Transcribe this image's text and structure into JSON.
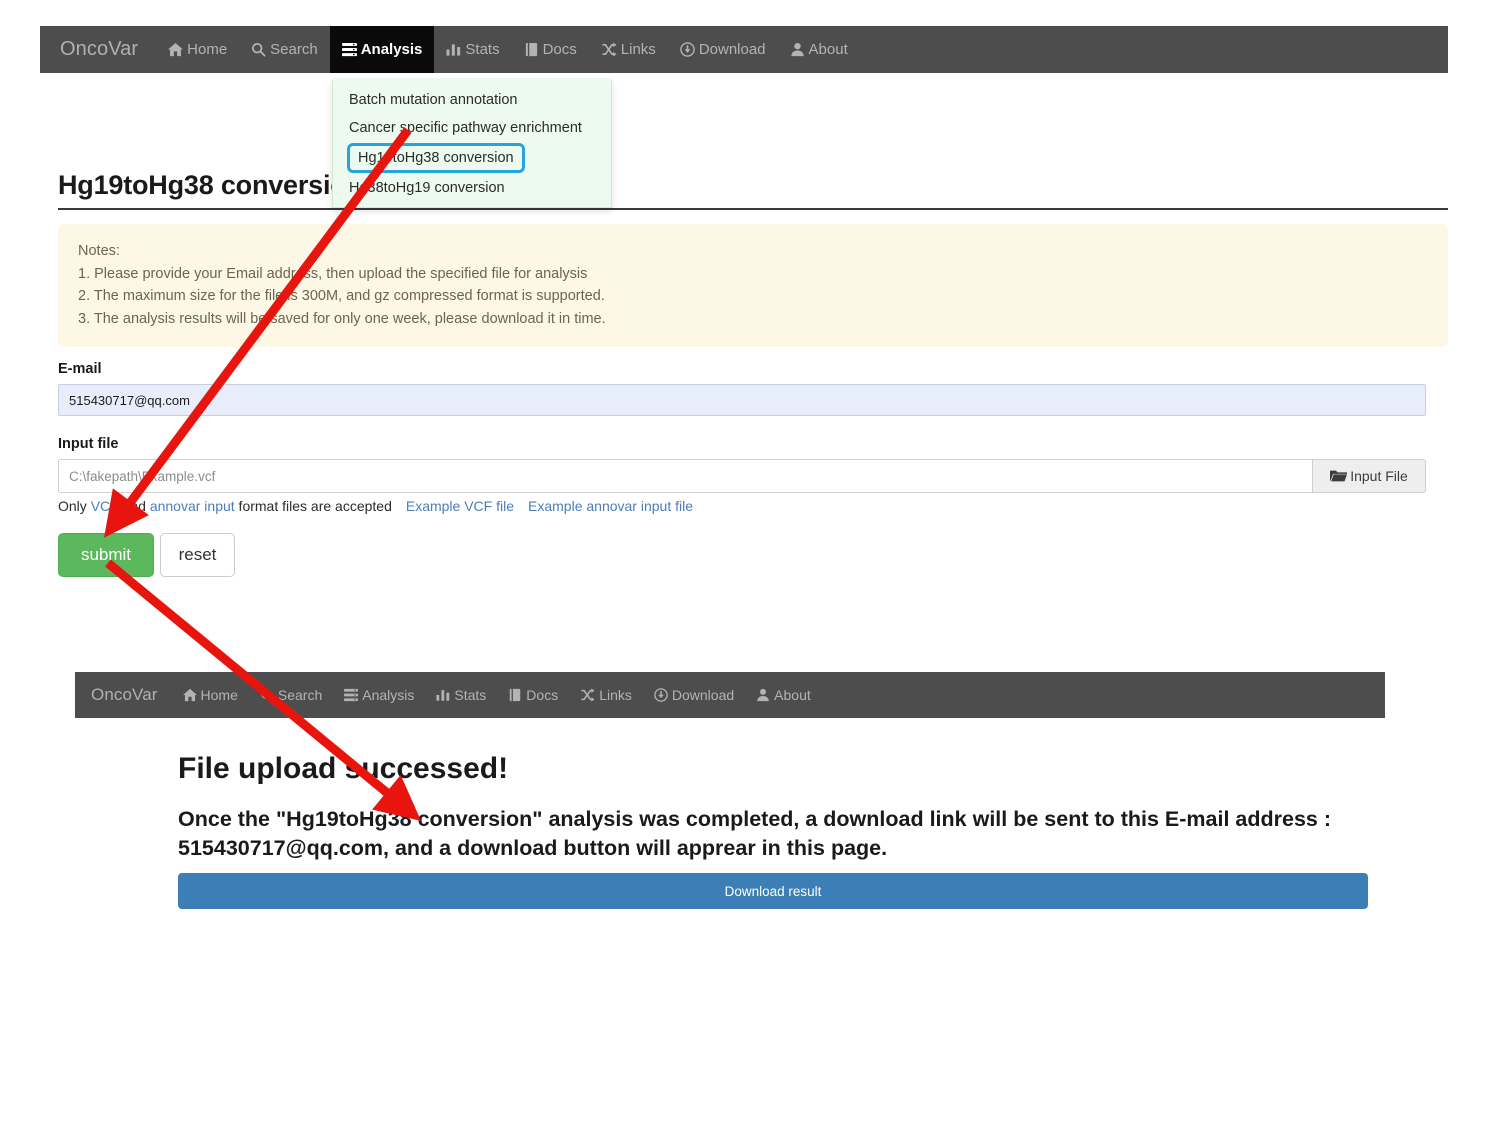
{
  "brand": "OncoVar",
  "nav": {
    "items": [
      {
        "label": "Home",
        "icon": "home-icon"
      },
      {
        "label": "Search",
        "icon": "search-icon"
      },
      {
        "label": "Analysis",
        "icon": "analysis-icon"
      },
      {
        "label": "Stats",
        "icon": "bar-chart-icon"
      },
      {
        "label": "Docs",
        "icon": "book-icon"
      },
      {
        "label": "Links",
        "icon": "shuffle-icon"
      },
      {
        "label": "Download",
        "icon": "download-circle-icon"
      },
      {
        "label": "About",
        "icon": "user-icon"
      }
    ],
    "active": "Analysis"
  },
  "dropdown": {
    "items": [
      "Batch mutation annotation",
      "Cancer specific pathway enrichment",
      "Hg19toHg38 conversion",
      "Hg38toHg19 conversion"
    ],
    "selected": "Hg19toHg38 conversion"
  },
  "page": {
    "title": "Hg19toHg38 conversion"
  },
  "notes": {
    "heading": "Notes:",
    "lines": [
      "1. Please provide your Email address, then upload the specified file for analysis",
      "2. The maximum size for the file is 300M, and gz compressed format is supported.",
      "3. The analysis results will be saved for only one week, please download it in time."
    ]
  },
  "form": {
    "email_label": "E-mail",
    "email_value": "515430717@qq.com",
    "file_label": "Input file",
    "file_value": "C:\\fakepath\\Example.vcf",
    "file_button": "Input File",
    "hint_prefix": "Only ",
    "hint_link1": "VCF",
    "hint_mid": " and ",
    "hint_link2": "annovar input",
    "hint_suffix": " format files are accepted",
    "example_vcf": "Example VCF file",
    "example_annovar": "Example annovar input file",
    "submit_label": "submit",
    "reset_label": "reset"
  },
  "result": {
    "title": "File upload successed!",
    "message": "Once the \"Hg19toHg38 conversion\" analysis was completed, a download link will be sent to this E-mail address : 515430717@qq.com, and a download button will apprear in this page.",
    "download_label": "Download result"
  },
  "colors": {
    "navbar_bg": "#4d4d4d",
    "navbar_active_bg": "#0a0a0a",
    "dropdown_bg": "#edfaef",
    "highlight_outline": "#29a3dd",
    "notes_bg": "#fdf8e5",
    "submit_green": "#5cb85c",
    "download_blue": "#3c7fb6",
    "link_blue": "#4a7ebb",
    "email_field_bg": "#e8edfb",
    "annotation_red": "#e8150e"
  }
}
